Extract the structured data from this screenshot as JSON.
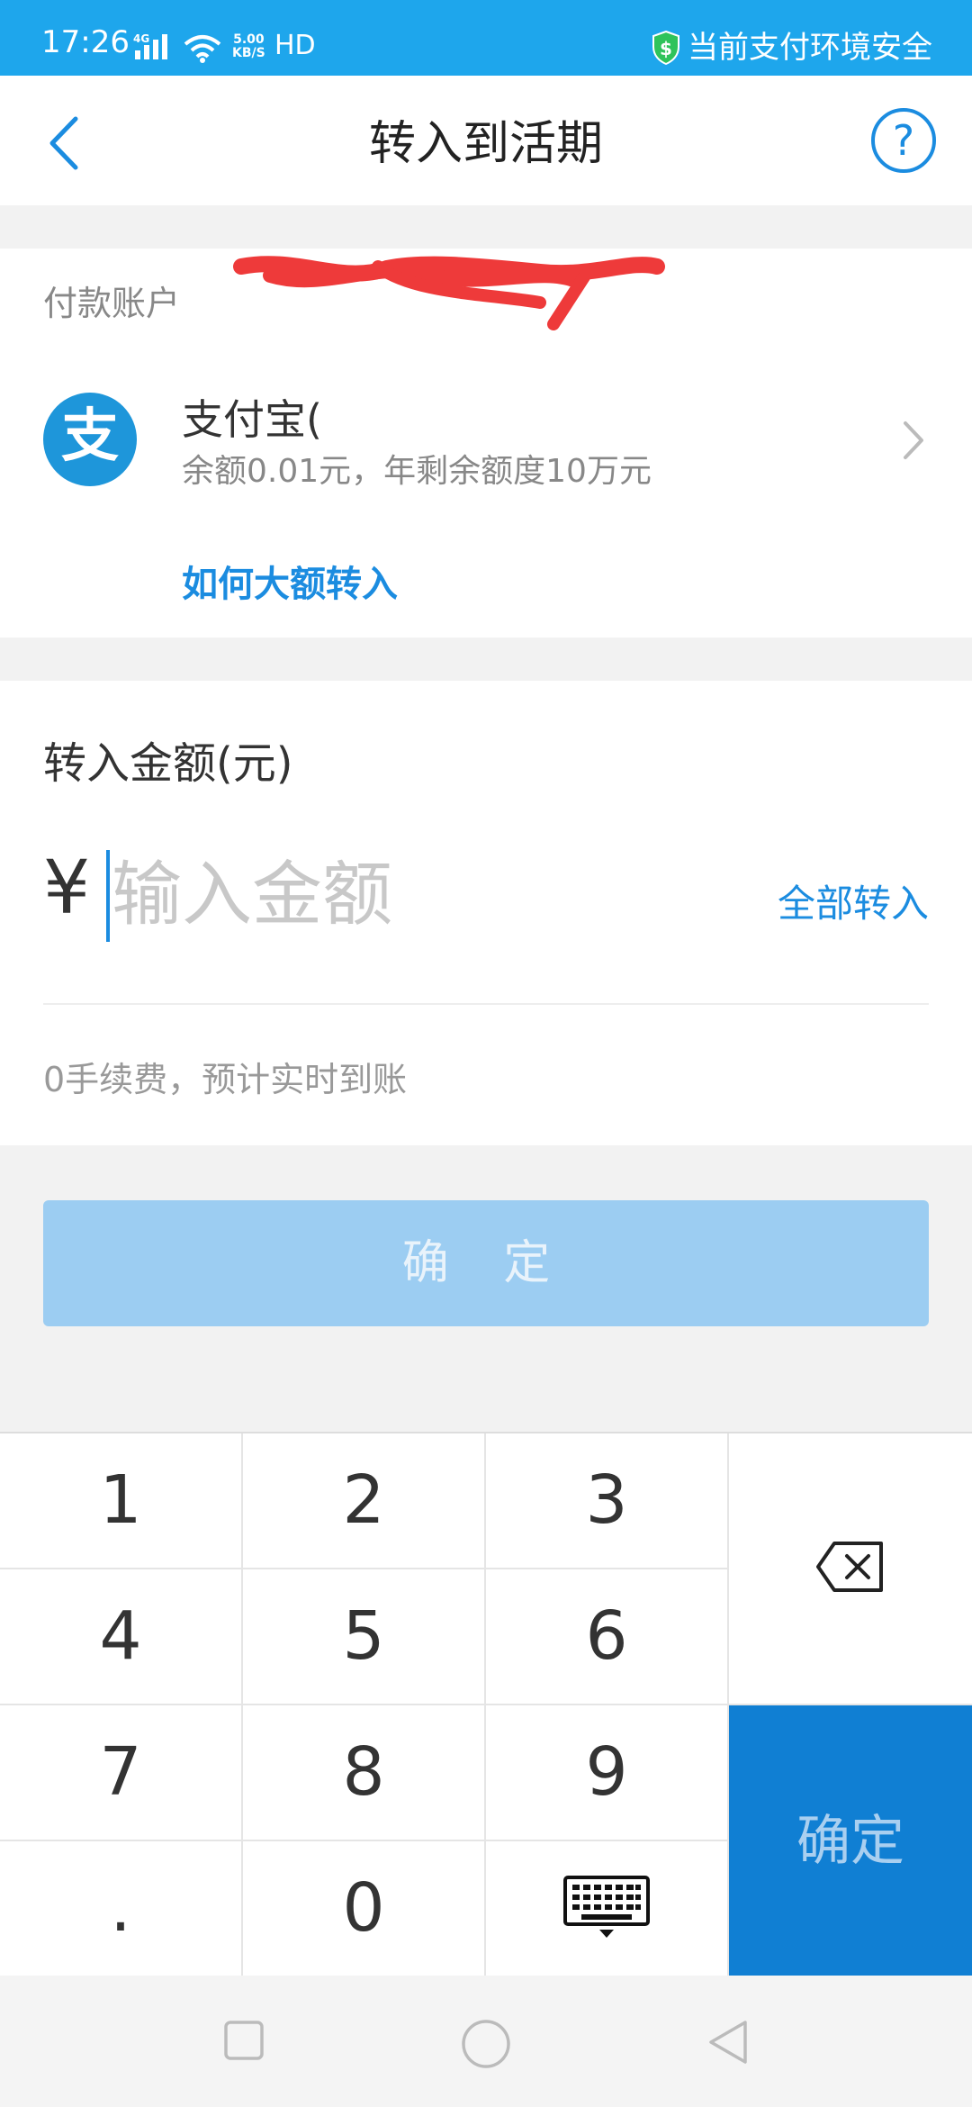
{
  "status_bar": {
    "time": "17:26",
    "network": "4G",
    "speed_value": "5.00",
    "speed_unit": "KB/S",
    "hd": "HD",
    "security_text": "当前支付环境安全"
  },
  "header": {
    "title": "转入到活期",
    "help_label": "?"
  },
  "payment": {
    "section_label": "付款账户",
    "account_name": "支付宝(",
    "balance_text": "余额0.01元，年剩余额度10万元",
    "how_link": "如何大额转入",
    "logo_char": "支"
  },
  "amount": {
    "label": "转入金额(元)",
    "currency": "¥",
    "placeholder": "输入金额",
    "all_in": "全部转入",
    "fee_note": "0手续费，预计实时到账"
  },
  "confirm_button": "确 定",
  "keypad": {
    "keys": [
      "1",
      "2",
      "3",
      "4",
      "5",
      "6",
      "7",
      "8",
      "9",
      ".",
      "0"
    ],
    "confirm": "确定"
  },
  "colors": {
    "status_bar": "#1ea6ec",
    "accent": "#1b8ce0",
    "confirm_disabled": "#9ccdf2",
    "keypad_confirm": "#107fd3"
  },
  "icons": [
    "signal-icon",
    "wifi-icon",
    "shield-icon",
    "back-icon",
    "help-icon",
    "chevron-right-icon",
    "backspace-icon",
    "keyboard-icon",
    "square-nav-icon",
    "circle-nav-icon",
    "triangle-nav-icon"
  ]
}
